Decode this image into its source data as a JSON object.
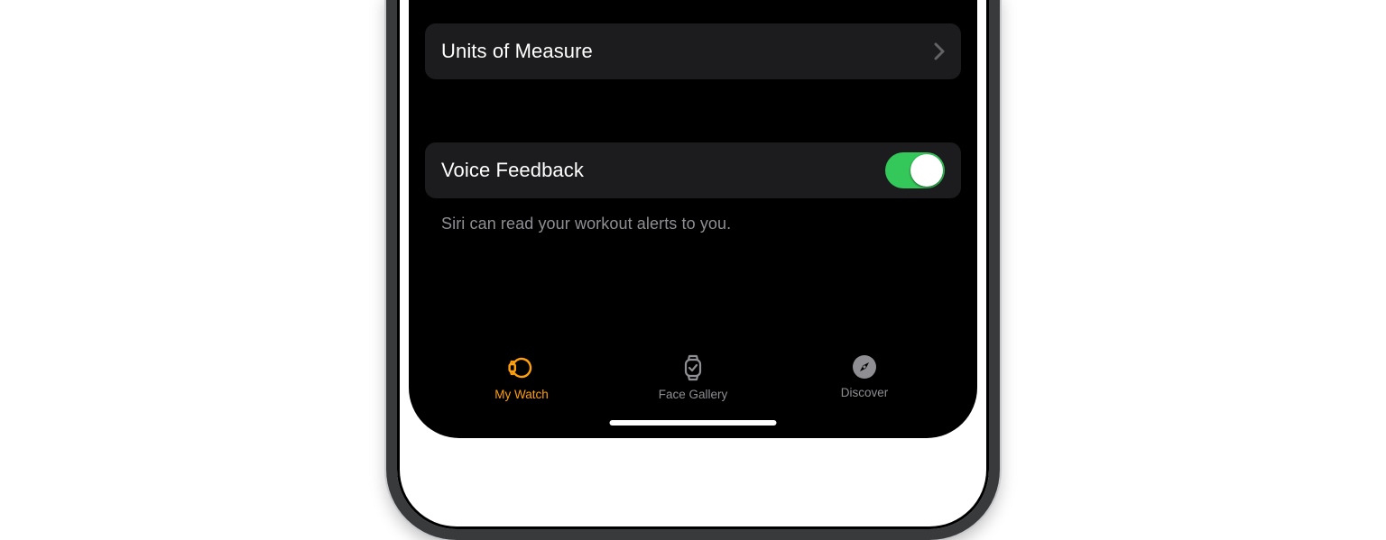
{
  "settings": {
    "units_of_measure": {
      "label": "Units of Measure"
    },
    "voice_feedback": {
      "label": "Voice Feedback",
      "on": true
    },
    "voice_feedback_hint": "Siri can read your workout alerts to you."
  },
  "tabs": {
    "my_watch": "My Watch",
    "face_gallery": "Face Gallery",
    "discover": "Discover"
  }
}
